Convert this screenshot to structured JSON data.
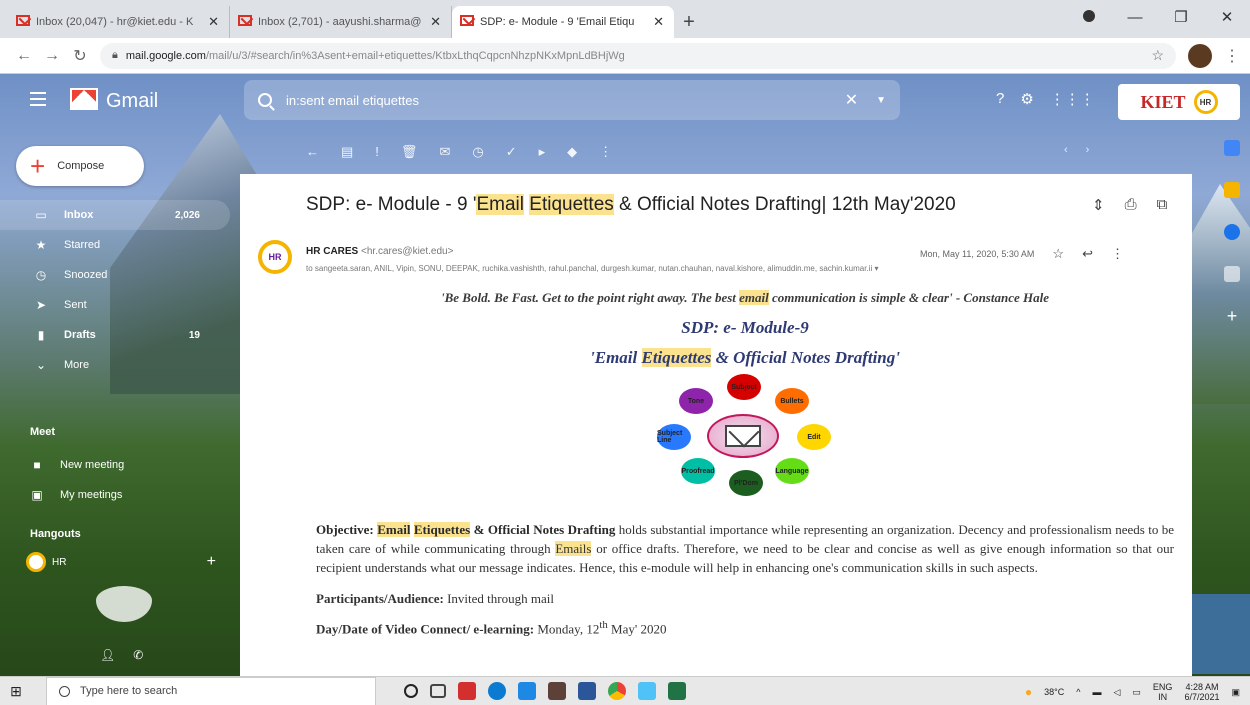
{
  "browser": {
    "tabs": [
      {
        "title": "Inbox (20,047) - hr@kiet.edu - K",
        "active": false
      },
      {
        "title": "Inbox (2,701) - aayushi.sharma@",
        "active": false
      },
      {
        "title": "SDP: e- Module - 9 'Email Etiqu",
        "active": true
      }
    ],
    "url_host": "mail.google.com",
    "url_path": "/mail/u/3/#search/in%3Asent+email+etiquettes/KtbxLthqCqpcnNhzpNKxMpnLdBHjWg"
  },
  "gmail": {
    "logo_text": "Gmail",
    "search_placeholder": "in:sent email etiquettes",
    "compose_label": "Compose",
    "nav": [
      {
        "label": "Inbox",
        "count": "2,026",
        "icon": "inbox-icon",
        "bold": true,
        "active": true
      },
      {
        "label": "Starred",
        "count": "",
        "icon": "star-icon",
        "bold": false,
        "active": false
      },
      {
        "label": "Snoozed",
        "count": "",
        "icon": "clock-icon",
        "bold": false,
        "active": false
      },
      {
        "label": "Sent",
        "count": "",
        "icon": "send-icon",
        "bold": false,
        "active": false
      },
      {
        "label": "Drafts",
        "count": "19",
        "icon": "file-icon",
        "bold": true,
        "active": false
      },
      {
        "label": "More",
        "count": "",
        "icon": "chevron-down-icon",
        "bold": false,
        "active": false
      }
    ],
    "meet_title": "Meet",
    "meet_items": [
      {
        "label": "New meeting",
        "icon": "video-icon"
      },
      {
        "label": "My meetings",
        "icon": "calendar-icon"
      }
    ],
    "hangouts_title": "Hangouts",
    "hangouts_user": "HR",
    "brand_badge": "KIET",
    "brand_badge_sub": "HR"
  },
  "email": {
    "subject_parts": {
      "pre": "SDP: e- Module - 9 '",
      "h1": "Email",
      "sp": " ",
      "h2": "Etiquettes",
      "post": " & Official Notes Drafting| 12th May'2020"
    },
    "sender_name": "HR CARES",
    "sender_email": "<hr.cares@kiet.edu>",
    "date": "Mon, May 11, 2020, 5:30 AM",
    "recipients": "to sangeeta.saran, ANIL, Vipin, SONU, DEEPAK, ruchika.vashishth, rahul.panchal, durgesh.kumar, nutan.chauhan, naval.kishore, alimuddin.me, sachin.kumar.ii ▾",
    "avatar_text": "HR",
    "quote_pre": "'Be Bold. Be Fast. Get to the point right away. The best ",
    "quote_hl": "email",
    "quote_post": " communication is simple & clear' - Constance Hale",
    "module_title": "SDP: e- Module-9",
    "module_sub_pre": "'Email ",
    "module_sub_hl": "Etiquettes",
    "module_sub_post": " & Official Notes Drafting'",
    "diagram_petals": [
      {
        "label": "Subject",
        "color": "#d50000"
      },
      {
        "label": "Bullets",
        "color": "#ff6d00"
      },
      {
        "label": "Edit",
        "color": "#ffd600"
      },
      {
        "label": "Language",
        "color": "#64dd17"
      },
      {
        "label": "Pl'Dom",
        "color": "#1b5e20"
      },
      {
        "label": "Proofread",
        "color": "#00bfa5"
      },
      {
        "label": "Subject Line",
        "color": "#2979ff"
      },
      {
        "label": "Tone",
        "color": "#8e24aa"
      }
    ],
    "objective_label": "Objective:",
    "objective_hl1": "Email",
    "objective_hl2": "Etiquettes",
    "objective_rest_bold": " & Official Notes Drafting",
    "objective_text_a": " holds substantial importance while representing an organization. Decency and professionalism needs to be taken care of while communicating through ",
    "objective_hl3": "Emails",
    "objective_text_b": " or office drafts. Therefore, we need to be clear and concise as well as give enough information so that our recipient understands what our message indicates. Hence, this e-module will help in enhancing one's communication skills in such aspects.",
    "participants_label": "Participants/Audience:",
    "participants_value": " Invited through mail",
    "day_label": "Day/Date of Video Connect/ e-learning:",
    "day_value": " Monday, 12",
    "day_sup": "th",
    "day_value2": " May' 2020"
  },
  "taskbar": {
    "search_placeholder": "Type here to search",
    "weather": "38°C",
    "lang": "ENG",
    "lang_sub": "IN",
    "time": "4:28 AM",
    "date": "6/7/2021"
  }
}
